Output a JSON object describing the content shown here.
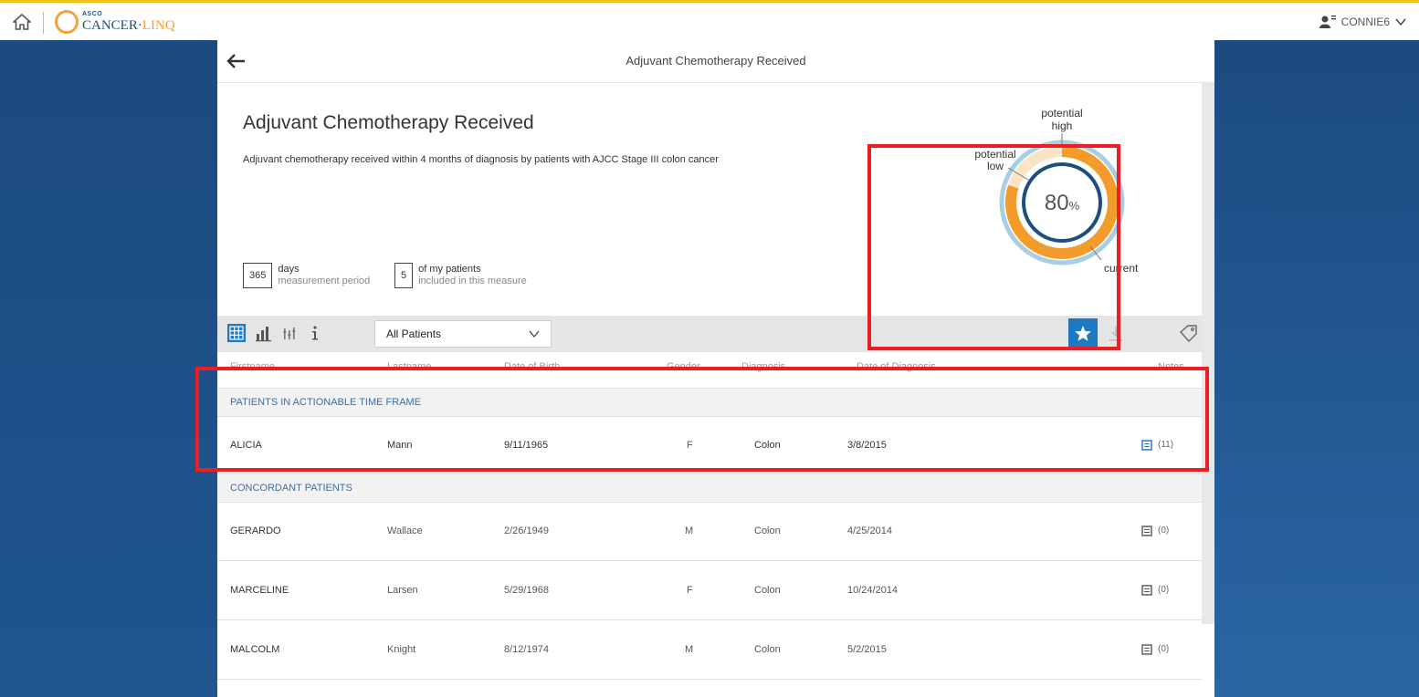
{
  "topbar": {
    "logo_asco": "ASCO",
    "logo_cancer": "CANCER",
    "logo_linq": "LINQ",
    "username": "CONNIE6"
  },
  "panel": {
    "title": "Adjuvant Chemotherapy Received"
  },
  "measure": {
    "title": "Adjuvant Chemotherapy Received",
    "description": "Adjuvant chemotherapy received within 4 months of diagnosis by patients with AJCC Stage III colon cancer",
    "period_days": "365",
    "period_label": "days",
    "period_sub": "measurement period",
    "patients_count": "5",
    "patients_label": "of my patients",
    "patients_sub": "included in this measure"
  },
  "chart_data": {
    "type": "pie",
    "center_value": "80",
    "center_unit": "%",
    "labels": {
      "potential_high": [
        "potential",
        "high"
      ],
      "potential_low": [
        "potential",
        "low"
      ],
      "current": "current"
    },
    "values": {
      "current": 80
    },
    "colors": {
      "current": "#f39c2c",
      "potential_low": "#1f4e7e",
      "potential_high": "#a7cfe3"
    }
  },
  "toolbar": {
    "filter_value": "All Patients",
    "accent": "#1e79c4"
  },
  "table": {
    "columns": [
      "Firstname",
      "Lastname",
      "Date of Birth",
      "Gender",
      "Diagnosis",
      "Date of Diagnosis",
      "Notes"
    ],
    "sections": [
      {
        "title": "PATIENTS IN ACTIONABLE TIME FRAME",
        "rows": [
          {
            "first": "ALICIA",
            "last": "Mann",
            "dob": "9/11/1965",
            "gender": "F",
            "diagnosis": "Colon",
            "dx_date": "3/8/2015",
            "notes": "(11)"
          }
        ]
      },
      {
        "title": "CONCORDANT PATIENTS",
        "rows": [
          {
            "first": "GERARDO",
            "last": "Wallace",
            "dob": "2/26/1949",
            "gender": "M",
            "diagnosis": "Colon",
            "dx_date": "4/25/2014",
            "notes": "(0)"
          },
          {
            "first": "MARCELINE",
            "last": "Larsen",
            "dob": "5/29/1968",
            "gender": "F",
            "diagnosis": "Colon",
            "dx_date": "10/24/2014",
            "notes": "(0)"
          },
          {
            "first": "MALCOLM",
            "last": "Knight",
            "dob": "8/12/1974",
            "gender": "M",
            "diagnosis": "Colon",
            "dx_date": "5/2/2015",
            "notes": "(0)"
          }
        ]
      }
    ]
  }
}
